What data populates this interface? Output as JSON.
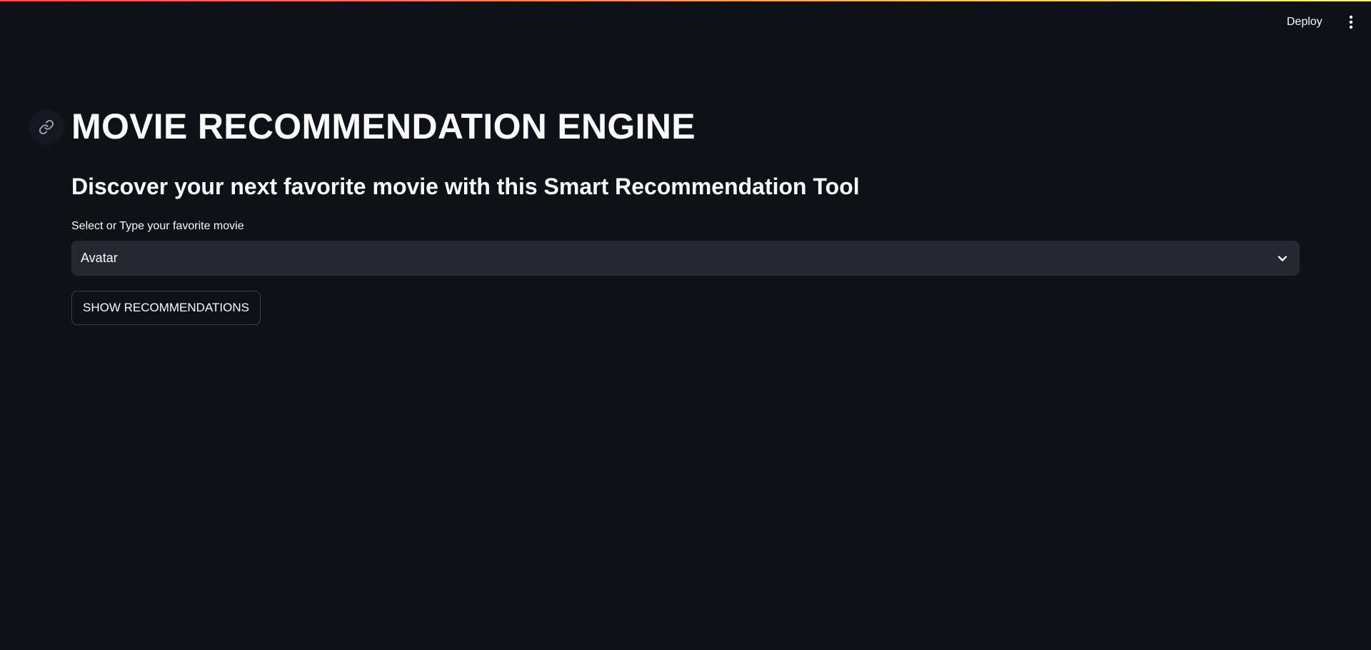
{
  "header": {
    "deploy_label": "Deploy",
    "menu_icon": "vertical-ellipsis-icon"
  },
  "colors": {
    "background": "#0e1117",
    "text": "#fafafa",
    "input_background": "#262730",
    "decoration_gradient": [
      "#ff4b4b",
      "#fffd80"
    ]
  },
  "main": {
    "anchor_icon": "link-icon",
    "title": "MOVIE RECOMMENDATION ENGINE",
    "subtitle": "Discover your next favorite movie with this Smart Recommendation Tool",
    "select": {
      "label": "Select or Type your favorite movie",
      "value": "Avatar",
      "icon": "chevron-down-icon"
    },
    "button_label": "SHOW RECOMMENDATIONS"
  }
}
